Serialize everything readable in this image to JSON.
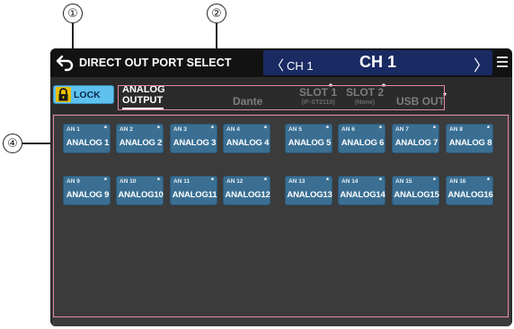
{
  "callouts": [
    "①",
    "②",
    "④"
  ],
  "header": {
    "title": "DIRECT OUT PORT SELECT",
    "prev_channel": "CH 1",
    "channel_name": "CH 1",
    "next_glyph": "〉",
    "prev_glyph": "〈"
  },
  "lock": {
    "label": "LOCK"
  },
  "tabs": {
    "analog": {
      "line1": "ANALOG",
      "line2": "OUTPUT"
    },
    "dante": {
      "label": "Dante"
    },
    "slot1": {
      "label": "SLOT 1",
      "sub": "(IF-ST2110)"
    },
    "slot2": {
      "label": "SLOT 2",
      "sub": "(None)"
    },
    "usb": {
      "label": "USB OUT"
    },
    "star": "*"
  },
  "ports": [
    {
      "label": "AN 1",
      "name": "ANALOG 1",
      "star": "*"
    },
    {
      "label": "AN 2",
      "name": "ANALOG 2",
      "star": "*"
    },
    {
      "label": "AN 3",
      "name": "ANALOG 3",
      "star": "*"
    },
    {
      "label": "AN 4",
      "name": "ANALOG 4",
      "star": "*"
    },
    {
      "label": "AN 5",
      "name": "ANALOG 5",
      "star": "*"
    },
    {
      "label": "AN 6",
      "name": "ANALOG 6",
      "star": "*"
    },
    {
      "label": "AN 7",
      "name": "ANALOG 7",
      "star": "*"
    },
    {
      "label": "AN 8",
      "name": "ANALOG 8",
      "star": "*"
    },
    {
      "label": "AN 9",
      "name": "ANALOG 9",
      "star": "*"
    },
    {
      "label": "AN 10",
      "name": "ANALOG10",
      "star": "*"
    },
    {
      "label": "AN 11",
      "name": "ANALOG11",
      "star": "*"
    },
    {
      "label": "AN 12",
      "name": "ANALOG12",
      "star": "*"
    },
    {
      "label": "AN 13",
      "name": "ANALOG13",
      "star": "*"
    },
    {
      "label": "AN 14",
      "name": "ANALOG14",
      "star": "*"
    },
    {
      "label": "AN 15",
      "name": "ANALOG15",
      "star": "*"
    },
    {
      "label": "AN 16",
      "name": "ANALOG16",
      "star": "*"
    }
  ]
}
